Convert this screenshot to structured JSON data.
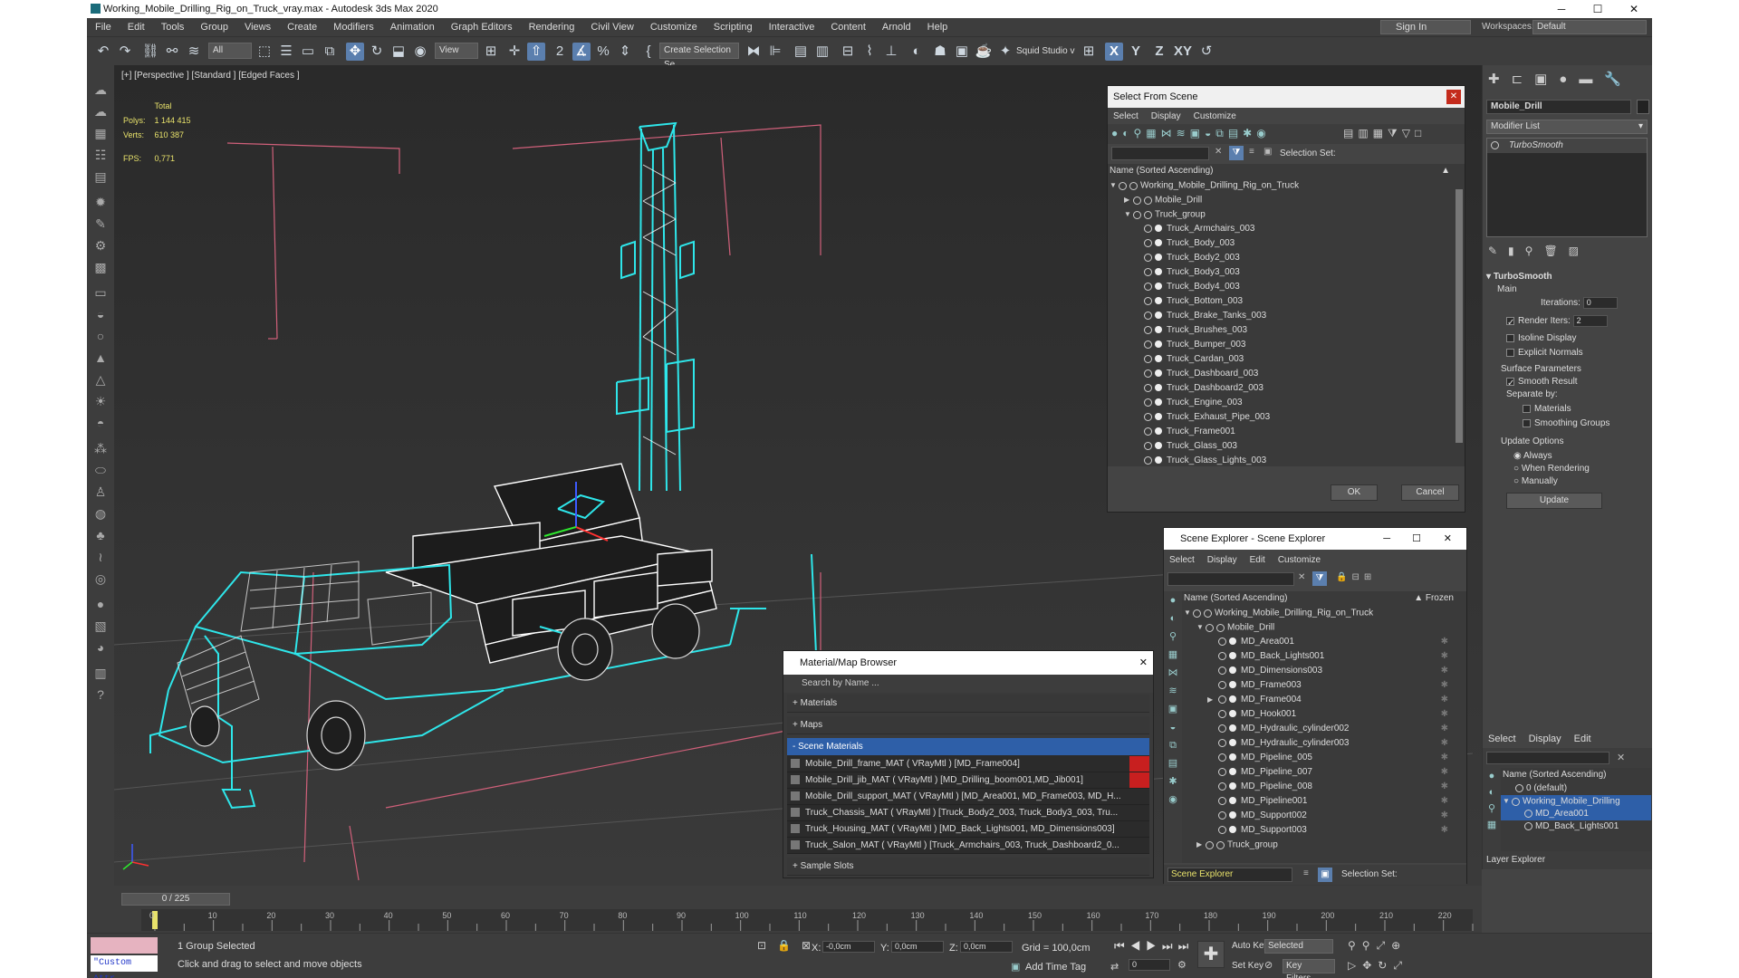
{
  "window": {
    "title": "Working_Mobile_Drilling_Rig_on_Truck_vray.max - Autodesk 3ds Max 2020",
    "controls": [
      "─",
      "☐",
      "✕"
    ]
  },
  "menu": [
    "File",
    "Edit",
    "Tools",
    "Group",
    "Views",
    "Create",
    "Modifiers",
    "Animation",
    "Graph Editors",
    "Rendering",
    "Civil View",
    "Customize",
    "Scripting",
    "Interactive",
    "Content",
    "Arnold",
    "Help"
  ],
  "signin": "Sign In",
  "workspaces": {
    "label": "Workspaces:",
    "value": "Default"
  },
  "toolbar": {
    "filter": "All",
    "refcoord": "View",
    "selset": "Create Selection Se",
    "squid": "Squid Studio v",
    "axes": [
      "X",
      "Y",
      "Z",
      "XY"
    ]
  },
  "viewport": {
    "label": "[+] [Perspective ] [Standard ] [Edged Faces ]",
    "stats": {
      "total": "Total",
      "polys_label": "Polys:",
      "polys": "1 144 415",
      "verts_label": "Verts:",
      "verts": "610 387",
      "fps_label": "FPS:",
      "fps": "0,771"
    }
  },
  "select_from_scene": {
    "title": "Select From Scene",
    "menu": [
      "Select",
      "Display",
      "Customize"
    ],
    "selset_label": "Selection Set:",
    "header": "Name (Sorted Ascending)",
    "root": "Working_Mobile_Drilling_Rig_on_Truck",
    "groups": [
      "Mobile_Drill",
      "Truck_group"
    ],
    "items": [
      "Truck_Armchairs_003",
      "Truck_Body_003",
      "Truck_Body2_003",
      "Truck_Body3_003",
      "Truck_Body4_003",
      "Truck_Bottom_003",
      "Truck_Brake_Tanks_003",
      "Truck_Brushes_003",
      "Truck_Bumper_003",
      "Truck_Cardan_003",
      "Truck_Dashboard_003",
      "Truck_Dashboard2_003",
      "Truck_Engine_003",
      "Truck_Exhaust_Pipe_003",
      "Truck_Frame001",
      "Truck_Glass_003",
      "Truck_Glass_Lights_003"
    ],
    "ok": "OK",
    "cancel": "Cancel"
  },
  "scene_explorer": {
    "title": "Scene Explorer - Scene Explorer",
    "menu": [
      "Select",
      "Display",
      "Edit",
      "Customize"
    ],
    "header": "Name (Sorted Ascending)",
    "frozen": "▲ Frozen",
    "root": "Working_Mobile_Drilling_Rig_on_Truck",
    "group": "Mobile_Drill",
    "items": [
      "MD_Area001",
      "MD_Back_Lights001",
      "MD_Dimensions003",
      "MD_Frame003",
      "MD_Frame004",
      "MD_Hook001",
      "MD_Hydraulic_cylinder002",
      "MD_Hydraulic_cylinder003",
      "MD_Pipeline_005",
      "MD_Pipeline_007",
      "MD_Pipeline_008",
      "MD_Pipeline001",
      "MD_Support002",
      "MD_Support003"
    ],
    "truck_group": "Truck_group",
    "footer_combo": "Scene Explorer",
    "selset_label": "Selection Set:"
  },
  "material_browser": {
    "title": "Material/Map Browser",
    "search": "Search by Name ...",
    "cats": [
      "+ Materials",
      "+ Maps",
      "- Scene Materials"
    ],
    "materials": [
      "Mobile_Drill_frame_MAT  ( VRayMtl ) [MD_Frame004]",
      "Mobile_Drill_jib_MAT  ( VRayMtl ) [MD_Drilling_boom001,MD_Jib001]",
      "Mobile_Drill_support_MAT  ( VRayMtl ) [MD_Area001, MD_Frame003, MD_H...",
      "Truck_Chassis_MAT  ( VRayMtl ) [Truck_Body2_003, Truck_Body3_003, Tru...",
      "Truck_Housing_MAT  ( VRayMtl ) [MD_Back_Lights001, MD_Dimensions003]",
      "Truck_Salon_MAT  ( VRayMtl ) [Truck_Armchairs_003, Truck_Dashboard2_0..."
    ],
    "samples": "+ Sample Slots"
  },
  "modify_panel": {
    "object_name": "Mobile_Drill",
    "modifier_list": "Modifier List",
    "stack": [
      "TurboSmooth"
    ],
    "rollout": "TurboSmooth",
    "main": "Main",
    "iterations_label": "Iterations:",
    "iterations": "0",
    "render_iters_label": "Render Iters:",
    "render_iters": "2",
    "isoline": "Isoline Display",
    "explicit": "Explicit Normals",
    "surface": "Surface Parameters",
    "smooth": "Smooth Result",
    "separate": "Separate by:",
    "materials": "Materials",
    "smoothing": "Smoothing Groups",
    "update_opts": "Update Options",
    "always": "Always",
    "when_rendering": "When Rendering",
    "manually": "Manually",
    "update": "Update"
  },
  "layer_explorer": {
    "menu": [
      "Select",
      "Display",
      "Edit"
    ],
    "header": "Name (Sorted Ascending)",
    "items": [
      "0 (default)",
      "Working_Mobile_Drilling",
      "MD_Area001",
      "MD_Back_Lights001"
    ],
    "footer": "Layer Explorer"
  },
  "timeline": {
    "slider": "0 / 225",
    "ticks": [
      "0",
      "10",
      "20",
      "30",
      "40",
      "50",
      "60",
      "70",
      "80",
      "90",
      "100",
      "110",
      "120",
      "130",
      "140",
      "150",
      "160",
      "170",
      "180",
      "190",
      "200",
      "210",
      "220"
    ]
  },
  "status": {
    "maxscript": "\"Custom Attr.",
    "selected": "1 Group Selected",
    "prompt": "Click and drag to select and move objects",
    "x_label": "X:",
    "x": "-0,0cm",
    "y_label": "Y:",
    "y": "0,0cm",
    "z_label": "Z:",
    "z": "0,0cm",
    "grid": "Grid = 100,0cm",
    "add_time_tag": "Add Time Tag",
    "auto_key": "Auto Key",
    "set_key": "Set Key",
    "key_mode": "Selected",
    "key_filters": "Key Filters...",
    "frame": "0"
  }
}
